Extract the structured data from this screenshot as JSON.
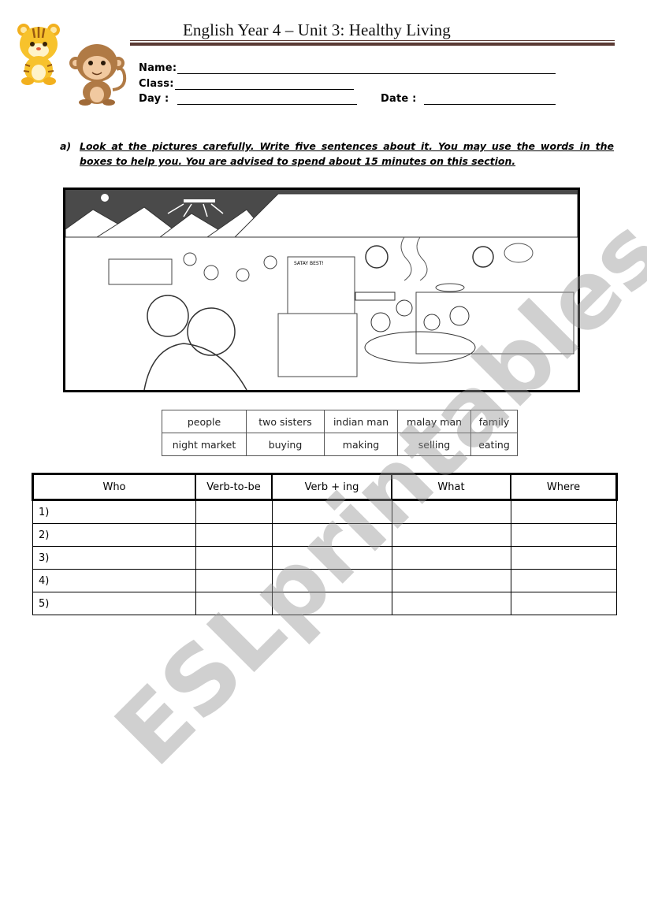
{
  "header": {
    "title": "English Year 4 – Unit 3: Healthy Living",
    "mascots": [
      "tiger-icon",
      "monkey-icon"
    ]
  },
  "student_fields": {
    "name_label": "Name:",
    "name_value": "",
    "class_label": "Class:",
    "class_value": "",
    "day_label": "Day :",
    "day_value": "",
    "date_label": "Date :",
    "date_value": ""
  },
  "instruction": {
    "marker": "a)",
    "text": "Look at the pictures carefully. Write five sentences about it. You may use the words in the boxes to help you. You are advised to spend about 15 minutes on this section."
  },
  "picture": {
    "description": "Black-and-white illustration of a night market: two sisters in front, an Indian man selling satay, a Malay man making roti, a family eating at a table",
    "stall_sign": "SATAY BEST!"
  },
  "word_bank": {
    "rows": [
      [
        "people",
        "two sisters",
        "indian man",
        "malay man",
        "family"
      ],
      [
        "night market",
        "buying",
        "making",
        "selling",
        "eating"
      ]
    ]
  },
  "answer_table": {
    "headers": [
      "Who",
      "Verb-to-be",
      "Verb + ing",
      "What",
      "Where"
    ],
    "rows": [
      [
        "1)",
        "",
        "",
        "",
        ""
      ],
      [
        "2)",
        "",
        "",
        "",
        ""
      ],
      [
        "3)",
        "",
        "",
        "",
        ""
      ],
      [
        "4)",
        "",
        "",
        "",
        ""
      ],
      [
        "5)",
        "",
        "",
        "",
        ""
      ]
    ]
  },
  "watermark": "ESLprintables.com"
}
